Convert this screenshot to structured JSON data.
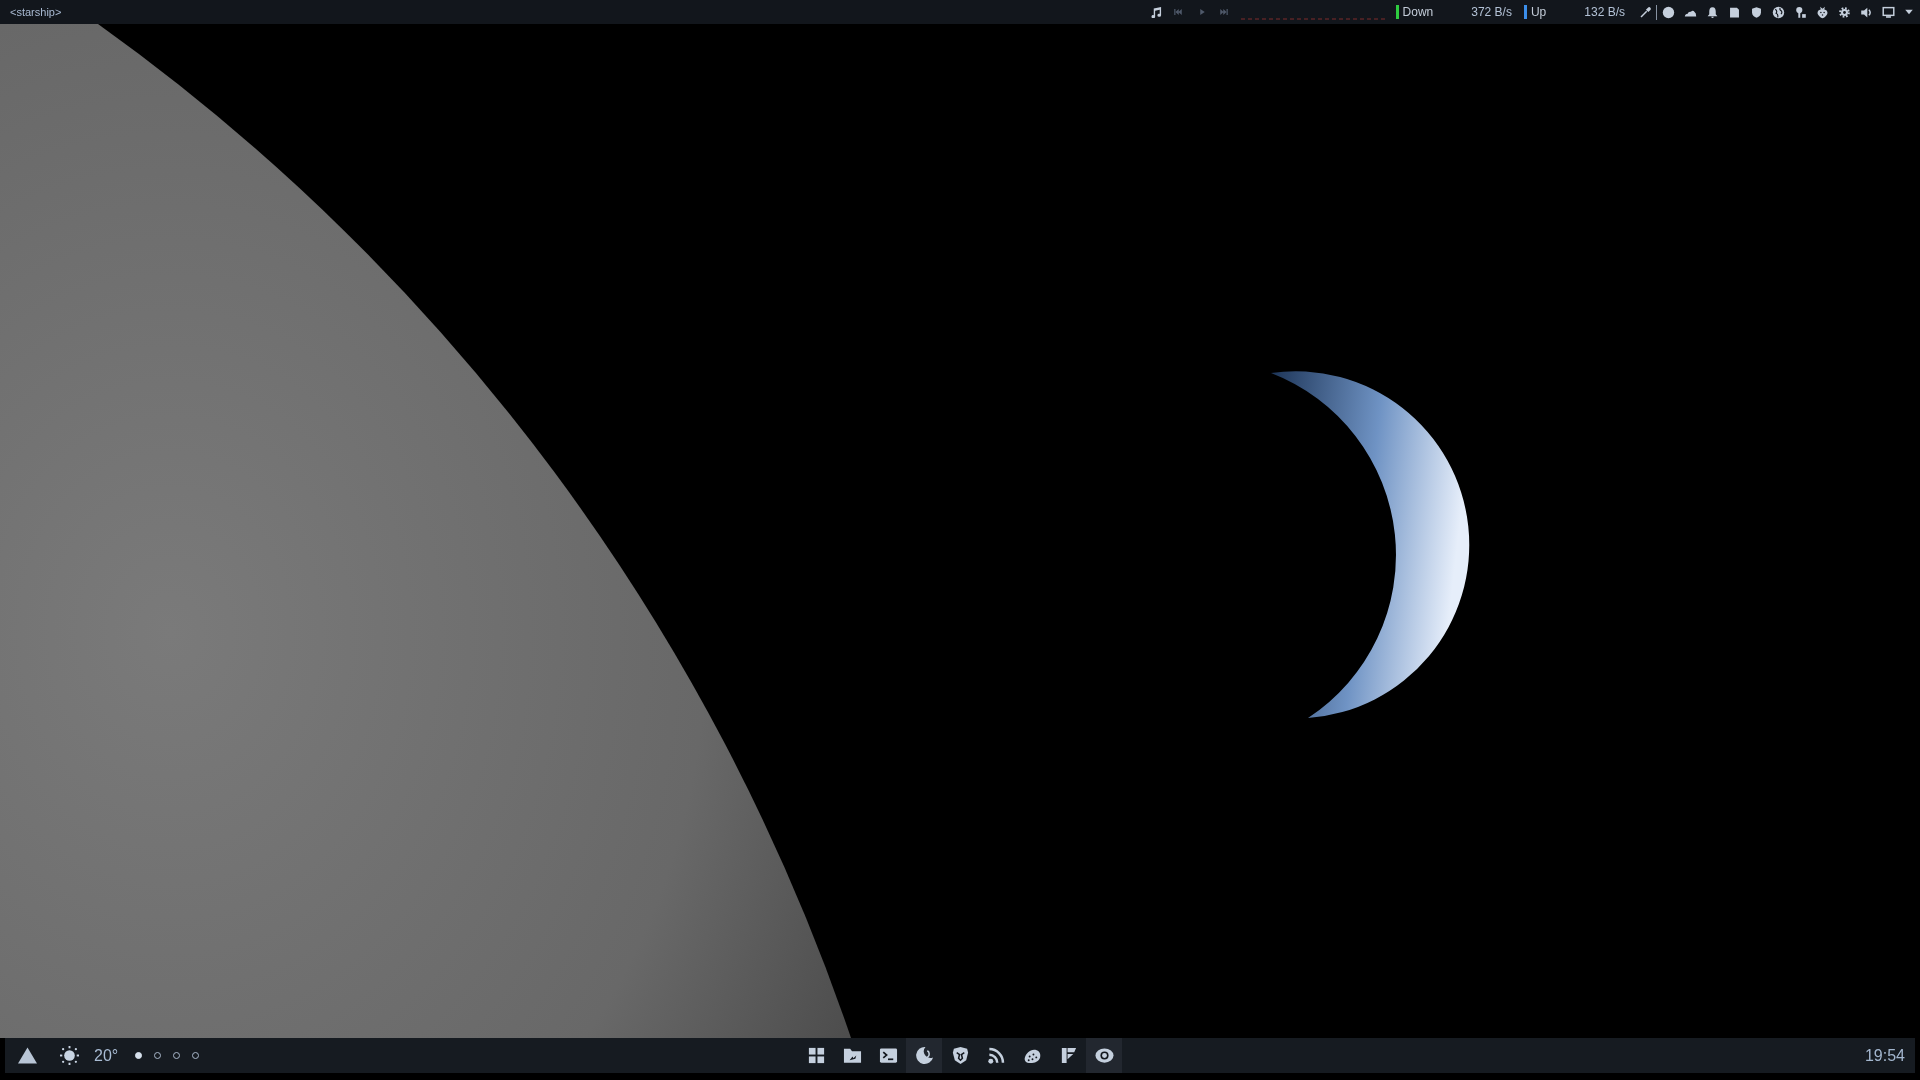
{
  "top_bar": {
    "window_title": "<starship>",
    "network": [
      {
        "label": "Down",
        "rate": "372 B/s",
        "color": "#2ecc40"
      },
      {
        "label": "Up",
        "rate": "132 B/s",
        "color": "#3b8eea"
      }
    ]
  },
  "bottom_panel": {
    "weather": {
      "temperature": "20°"
    },
    "workspaces": [
      {
        "selected": true
      },
      {
        "selected": false
      },
      {
        "selected": false
      },
      {
        "selected": false
      }
    ],
    "taskbar": [
      {
        "active": false
      },
      {
        "active": false
      },
      {
        "active": false
      },
      {
        "active": true
      },
      {
        "active": false
      },
      {
        "active": false
      },
      {
        "active": false
      },
      {
        "active": false
      },
      {
        "active": true
      }
    ],
    "clock": "19:54"
  }
}
